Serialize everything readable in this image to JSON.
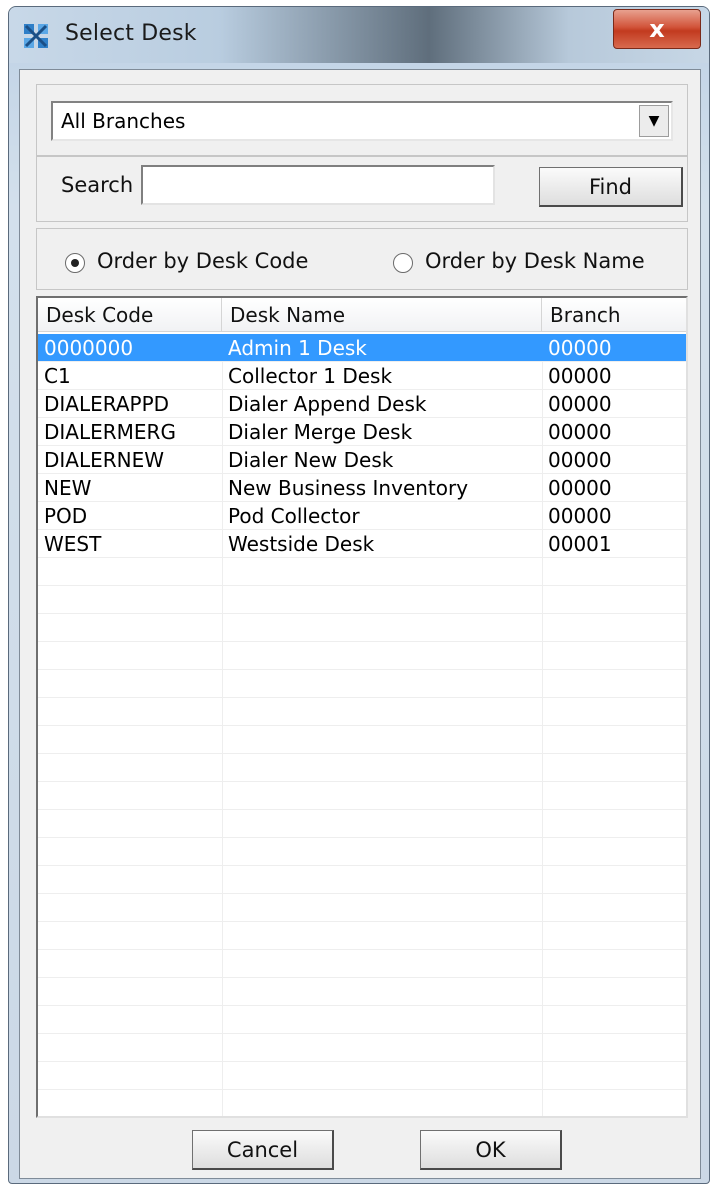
{
  "window": {
    "title": "Select Desk",
    "close_label": "x"
  },
  "branch_select": {
    "value": "All Branches"
  },
  "search": {
    "label": "Search",
    "value": "",
    "find_label": "Find"
  },
  "order": {
    "by_code_label": "Order by Desk Code",
    "by_name_label": "Order by Desk Name",
    "selected": "code"
  },
  "table": {
    "columns": [
      "Desk Code",
      "Desk Name",
      "Branch"
    ],
    "rows": [
      [
        "0000000",
        "Admin 1 Desk",
        "00000"
      ],
      [
        "C1",
        "Collector 1 Desk",
        "00000"
      ],
      [
        "DIALERAPPD",
        "Dialer Append Desk",
        "00000"
      ],
      [
        "DIALERMERG",
        "Dialer Merge Desk",
        "00000"
      ],
      [
        "DIALERNEW",
        "Dialer New Desk",
        "00000"
      ],
      [
        "NEW",
        "New Business Inventory",
        "00000"
      ],
      [
        "POD",
        "Pod Collector",
        "00000"
      ],
      [
        "WEST",
        "Westside Desk",
        "00001"
      ]
    ],
    "selected_row": 0
  },
  "footer": {
    "cancel_label": "Cancel",
    "ok_label": "OK"
  }
}
